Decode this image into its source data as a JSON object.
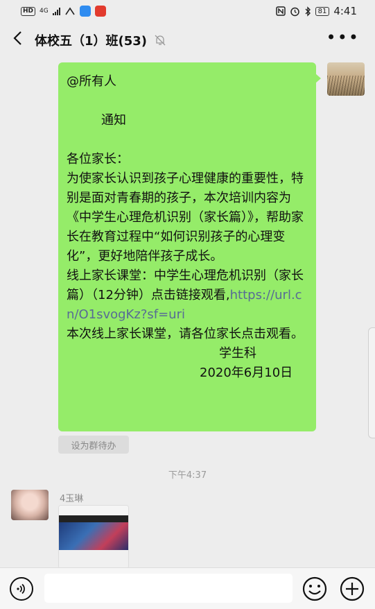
{
  "status_bar": {
    "hd": "HD",
    "network": "4G",
    "battery": "81",
    "time": "4:41"
  },
  "nav": {
    "title": "体校五（1）班(53)"
  },
  "message": {
    "lines": [
      "@所有人",
      "",
      "通知",
      "",
      "各位家长：",
      "为使家长认识到孩子心理健康的重要性，特别是面对青春期的孩子，本次培训内容为《中学生心理危机识别（家长篇）》，帮助家长在教育过程中“如何识别孩子的心理变化”，更好地陪伴孩子成长。",
      "线上家长课堂：中学生心理危机识别（家长篇）（12分钟）点击链接观看，"
    ],
    "mention": "@所有人",
    "notice": "通知",
    "greeting": "各位家长：",
    "body": "为使家长认识到孩子心理健康的重要性，特别是面对青春期的孩子，本次培训内容为《中学生心理危机识别（家长篇）》，帮助家长在教育过程中“如何识别孩子的心理变化”，更好地陪伴孩子成长。",
    "course": "线上家长课堂：中学生心理危机识别（家长篇）（12分钟）点击链接观看,",
    "link": "https://url.cn/O1svogKz?sf=uri",
    "closing": "本次线上家长课堂，请各位家长点击观看。",
    "signature": "学生科",
    "date": "2020年6月10日"
  },
  "todo_button": "设为群待办",
  "timestamp": "下午4:37",
  "other_message": {
    "sender": "4玉琳"
  },
  "icons": [
    "back-arrow-icon",
    "mute-bell-icon",
    "more-icon",
    "voice-icon",
    "emoji-icon",
    "plus-icon"
  ],
  "colors": {
    "bubble": "#95ec69",
    "link": "#576b95",
    "background": "#ededed"
  }
}
